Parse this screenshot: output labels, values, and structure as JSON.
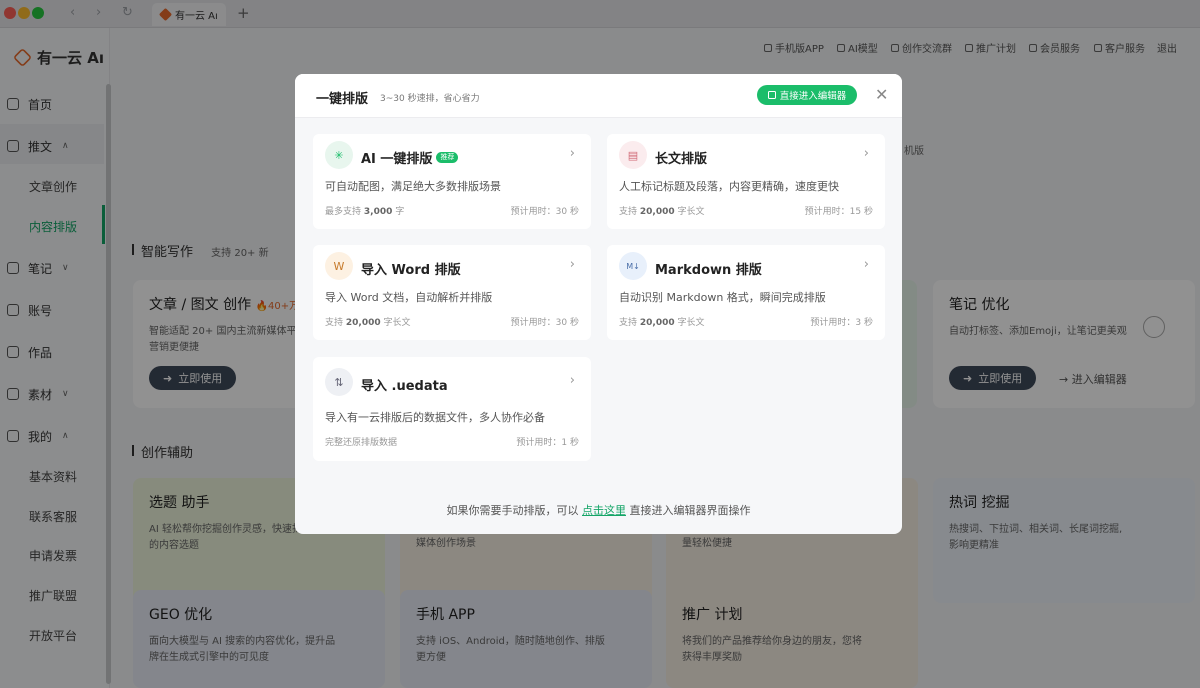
{
  "window": {
    "tab_title": "有一云 Aı",
    "tab_add": "+"
  },
  "app": {
    "brand": "有一云 Aı",
    "top_nav": [
      "手机版APP",
      "AI模型",
      "创作交流群",
      "推广计划",
      "会员服务",
      "客户服务",
      "退出"
    ],
    "sidebar": {
      "items": [
        {
          "label": "首页",
          "icon": "home-icon"
        },
        {
          "label": "推文",
          "icon": "tweet-icon",
          "expanded": true
        },
        {
          "label": "笔记",
          "icon": "note-icon",
          "expanded": false
        },
        {
          "label": "账号",
          "icon": "account-icon"
        },
        {
          "label": "作品",
          "icon": "works-icon"
        },
        {
          "label": "素材",
          "icon": "material-icon",
          "expanded": false
        },
        {
          "label": "我的",
          "icon": "user-icon",
          "expanded": true
        }
      ],
      "tweet_sub": [
        "文章创作",
        "内容排版"
      ],
      "mine_sub": [
        "基本资料",
        "联系客服",
        "申请发票",
        "推广联盟",
        "开放平台"
      ],
      "active_sub": "内容排版"
    },
    "sections": {
      "smart_writing": "智能写作",
      "smart_writing_note": "支持 20+ 新",
      "creation_aid": "创作辅助"
    },
    "cards": {
      "article": {
        "title": "文章 / 图文 创作",
        "badge": "🔥40+万人",
        "desc1": "智能适配 20+ 国内主流新媒体平台",
        "desc2": "营销更便捷",
        "button": "立即使用"
      },
      "note_opt": {
        "title": "笔记 优化",
        "desc": "自动打标签、添加Emoji，让笔记更美观",
        "button": "立即使用",
        "link": "进入编辑器"
      },
      "topic": {
        "title": "选题 助手",
        "desc1": "AI 轻松帮你挖掘创作灵感，快速找",
        "desc2": "的内容选题"
      },
      "media": {
        "desc": "媒体创作场景"
      },
      "light": {
        "desc": "量轻松便捷"
      },
      "hotword": {
        "title": "热词 挖掘",
        "desc1": "热搜词、下拉词、相关词、长尾词挖掘,",
        "desc2": "影响更精准"
      },
      "geo": {
        "title": "GEO 优化",
        "desc1": "面向大模型与 AI 搜索的内容优化，提升品",
        "desc2": "牌在生成式引擎中的可见度"
      },
      "mobile": {
        "title": "手机 APP",
        "desc1": "支持 iOS、Android，随时随地创作、排版",
        "desc2": "更方便"
      },
      "promo": {
        "title": "推广 计划",
        "desc1": "将我们的产品推荐给你身边的朋友，您将",
        "desc2": "获得丰厚奖励"
      },
      "partial": "机版"
    }
  },
  "modal": {
    "title": "一键排版",
    "subtitle": "3~30 秒速排，省心省力",
    "editor_button": "直接进入编辑器",
    "options": [
      {
        "title": "AI 一键排版",
        "badge": "推荐",
        "desc": "可自动配图，满足绝大多数排版场景",
        "meta_prefix": "最多支持",
        "meta_value": "3,000",
        "meta_suffix": "字",
        "time": "预计用时：30 秒",
        "icon": "ai-sparkle-icon"
      },
      {
        "title": "长文排版",
        "badge": "",
        "desc": "人工标记标题及段落，内容更精确，速度更快",
        "meta_prefix": "支持",
        "meta_value": "20,000",
        "meta_suffix": "字长文",
        "time": "预计用时：15 秒",
        "icon": "document-icon"
      },
      {
        "title": "导入 Word 排版",
        "badge": "",
        "desc": "导入 Word 文档，自动解析并排版",
        "meta_prefix": "支持",
        "meta_value": "20,000",
        "meta_suffix": "字长文",
        "time": "预计用时：30 秒",
        "icon": "word-icon"
      },
      {
        "title": "Markdown 排版",
        "badge": "",
        "desc": "自动识别 Markdown 格式，瞬间完成排版",
        "meta_prefix": "支持",
        "meta_value": "20,000",
        "meta_suffix": "字长文",
        "time": "预计用时：3 秒",
        "icon": "markdown-icon"
      },
      {
        "title": "导入 .uedata",
        "badge": "",
        "desc": "导入有一云排版后的数据文件，多人协作必备",
        "meta_prefix": "完整还原排版数据",
        "meta_value": "",
        "meta_suffix": "",
        "time": "预计用时：1 秒",
        "icon": "uedata-icon"
      }
    ],
    "footer_prefix": "如果你需要手动排版，可以",
    "footer_link": "点击这里",
    "footer_suffix": "直接进入编辑器界面操作"
  },
  "colors": {
    "accent": "#14a567",
    "button_green": "#1bbd6a",
    "overlay": "rgba(0,0,0,0.43)"
  }
}
